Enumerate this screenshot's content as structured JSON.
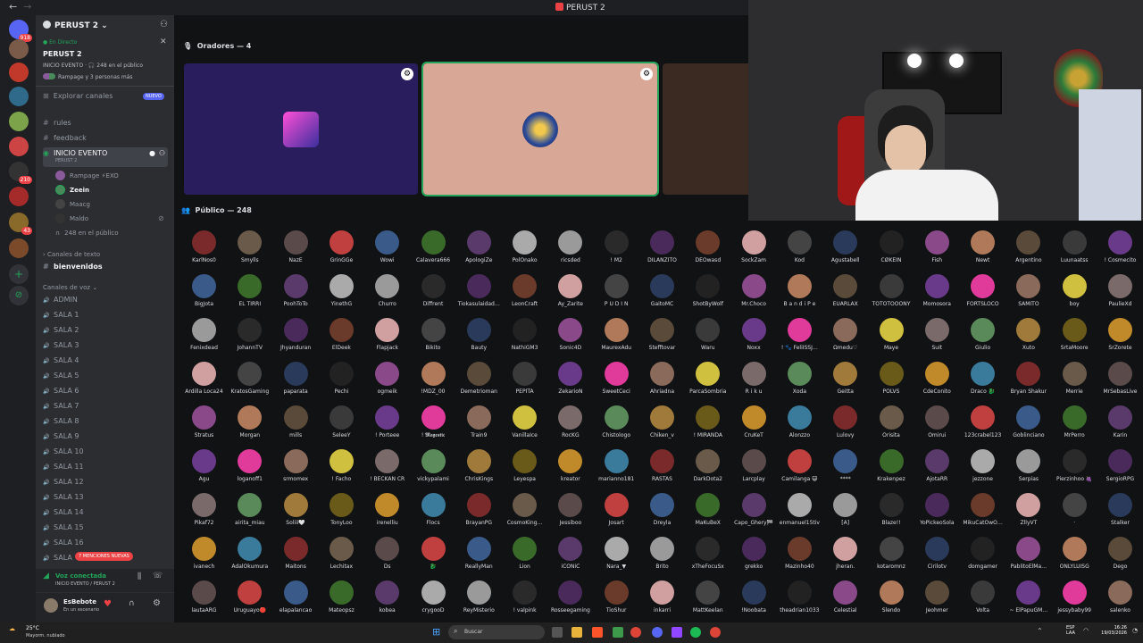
{
  "window": {
    "title": "PERUST 2",
    "back": "←",
    "forward": "→"
  },
  "guilds": [
    {
      "badge": "918",
      "color": "#5865f2"
    },
    {
      "badge": "",
      "color": "#7a5a48"
    },
    {
      "badge": "",
      "color": "#c0392b"
    },
    {
      "badge": "",
      "color": "#2f6a8a"
    },
    {
      "badge": "",
      "color": "#7da34a"
    },
    {
      "badge": "",
      "color": "#c44"
    },
    {
      "badge": "210",
      "color": "#333"
    },
    {
      "badge": "",
      "color": "#a52a2a"
    },
    {
      "badge": "43",
      "color": "#8a6a2a"
    },
    {
      "badge": "",
      "color": "#7a4a2a"
    }
  ],
  "server": {
    "name": "PERUST 2",
    "live_label": "● En Directo",
    "stage_title": "PERUST 2",
    "event_line": "INICIO EVENTO · 🎧 248 en el público",
    "people_line": "Rampage y 3 personas más",
    "explore": "Explorar canales",
    "new_badge": "NUEVO",
    "channels_top": [
      "rules",
      "feedback"
    ],
    "stage_channel": {
      "name": "INICIO EVENTO",
      "sub": "PERUST 2"
    },
    "stage_users": [
      {
        "name": "Rampage ⚡EXO",
        "color": "#8a5a9a"
      },
      {
        "name": "Zeein",
        "color": "#4a8a5a"
      },
      {
        "name": "Maacg",
        "color": "#444"
      },
      {
        "name": "Maldo",
        "color": "#333"
      }
    ],
    "audience_count": "248 en el público",
    "text_category": "Canales de texto",
    "text_channel": "bienvenidos",
    "voice_category": "Canales de voz",
    "voice_channels": [
      "ADMIN",
      "SALA 1",
      "SALA 2",
      "SALA 3",
      "SALA 4",
      "SALA 5",
      "SALA 6",
      "SALA 7",
      "SALA 8",
      "SALA 9",
      "SALA 10",
      "SALA 11",
      "SALA 12",
      "SALA 13",
      "SALA 14",
      "SALA 15",
      "SALA 16",
      "SALA"
    ],
    "mentions": "7 MENCIONES NUEVAS"
  },
  "user_panel": {
    "voice_status": "Voz conectada",
    "voice_location": "INICIO EVENTO / PERUST 2",
    "username": "EsBebote",
    "user_status": "En un escenario"
  },
  "stage": {
    "speakers_label": "Oradores — 4",
    "audience_label": "Público — 248"
  },
  "audience": [
    "KarlÑos0",
    "Smylls",
    "NazE",
    "GrinGGe",
    "Wowi",
    "Calavera666",
    "ApologiZe",
    "PolOnako",
    "ricsded",
    "! M2",
    "DILANZITO",
    "DEOwasd",
    "SockZam",
    "Kod",
    "Agustabell",
    "CØKEIN",
    "Fish",
    "Newt",
    "Argentino",
    "Luunaatss",
    "! Cosmecito",
    "BigJota",
    "EL TIRRI",
    "PoohToTo",
    "YinethG",
    "Churro",
    "Diffrent",
    "Tiokasulaidad…",
    "LeonCraft",
    "Ay_Zarite",
    "P U D I N",
    "GaitoMC",
    "ShotByWolf",
    "Mr.Choco",
    "B a n d i P e",
    "EUARLAX",
    "TOTOTOOONY",
    "Momosora",
    "FORTSLOCO",
    "SAMITO",
    "boy",
    "PaulieXd",
    "Fenixdead",
    "JohannTV",
    "Jhyanduran",
    "ElDeek",
    "Flapjack",
    "Bikito",
    "Bauty",
    "NathiGM3",
    "Sonic4D",
    "MaurexAdu",
    "Stefftovar",
    "Waru",
    "Noxx",
    "! 🐾 FeliISSJ…",
    "Ωmedu♡",
    "Maye",
    "Suit",
    "Giulio",
    "Xuto",
    "SrtaMoore",
    "SrZorete",
    "Ardilla Loca24",
    "KratosGaming",
    "paparata",
    "Pechi",
    "ogmeik",
    "!MDZ_00",
    "Demetrioman",
    "PEPITA",
    "ZekarioN",
    "SweetCeci",
    "Ahriadna",
    "ParcaSombria",
    "R i k u",
    "Xoda",
    "Geitta",
    "POLVS",
    "CdeConito",
    "Draco 🐉",
    "Bryan Shakur",
    "Merrie",
    "MrSebasLive",
    "Stratus",
    "Morgan",
    "mills",
    "SeleeY",
    "! Porteee",
    "! 𝕸𝖆𝖌𝖊𝖘𝖙𝖎𝖈",
    "Train9",
    "VanillaIce",
    "RocKG",
    "Chistologo",
    "Chiken_v",
    "! MIRANDA",
    "CruKeT",
    "Alonzzo",
    "Lulovy",
    "Orisita",
    "Omirui",
    "123crabel123",
    "Goblinciano",
    "MrPerro",
    "Karin",
    "Agu",
    "loganoff1",
    "srmomex",
    "! Facho",
    "! BECKAN CR",
    "vickypalami",
    "ChrisKings",
    "Leyespa",
    "kreator",
    "marianno181",
    "RASTAS",
    "DarkDota2",
    "Larcplay",
    "Camilanga 😺",
    "****",
    "Krakenpez",
    "AjotaRR",
    "jezzone",
    "Serpias",
    "Pierzinhoo 🍇",
    "SergioRPG",
    "Pikaf72",
    "airita_miau",
    "Soliii🤍",
    "TonyLoo",
    "irenelliu",
    "Flocs",
    "BrayanPG",
    "CosmoKing…",
    "Jessiboo",
    "Josart",
    "Dreyla",
    "MaKuBeX",
    "Capo_Ghery🏁",
    "enmanuel15tiv",
    "[A]",
    "Blaze!!",
    "YoPickeoSola",
    "MikuCatOwO…",
    "ZllyVT",
    "·",
    "Stalker",
    "ivanech",
    "AdalOkumura",
    "Maitons",
    "Lechitax",
    "Ds",
    "🐉",
    "ReallyMan",
    "Lion",
    "iCONiC",
    "Nara_▼",
    "Brito",
    "xTheFocuSx",
    "grekko",
    "Mazinho40",
    "jheran.",
    "kotaromnz",
    "Cirilotv",
    "domgamer",
    "PablitoElMa…",
    "ONLYLUISG",
    "Dego",
    "lautaARG",
    "Uruguayo🔴",
    "elapalancao",
    "Mateopsz",
    "kobea",
    "crygooD",
    "ReyMisterio",
    "! valpink",
    "Rosseegaming",
    "TioShur",
    "inkarri",
    "MattKeelan",
    "!Noobata",
    "theadrian1033",
    "Celestial",
    "Slendo",
    "Jeohmer",
    "Volta",
    "~ ElPapuGM…",
    "jessybaby99",
    "salenko"
  ],
  "taskbar": {
    "weather_temp": "25°C",
    "weather_desc": "Mayorm. nublado",
    "search_placeholder": "Buscar",
    "lang": "ESP",
    "lang2": "LAA",
    "time": "16:26",
    "date": "19/03/2026"
  },
  "colors": {
    "sidebar": "#2b2d31",
    "guild_bar": "#1e1f22",
    "stage_bg": "#111214",
    "speaker1": "#2a1d5e",
    "speaker2": "#d9a796",
    "accent": "#5865f2",
    "live": "#23a55a"
  }
}
